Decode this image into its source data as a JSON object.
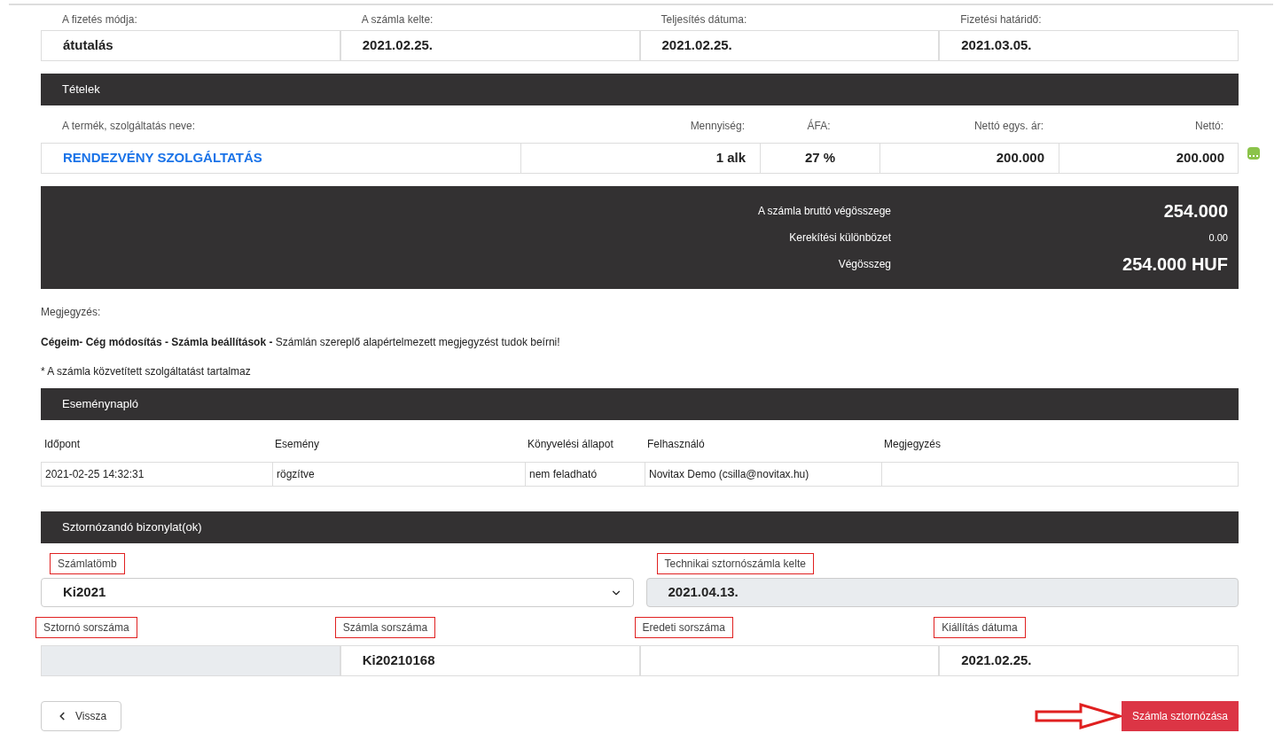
{
  "payment": [
    {
      "label": "A fizetés módja:",
      "value": "átutalás"
    },
    {
      "label": "A számla kelte:",
      "value": "2021.02.25."
    },
    {
      "label": "Teljesítés dátuma:",
      "value": "2021.02.25."
    },
    {
      "label": "Fizetési határidő:",
      "value": "2021.03.05."
    }
  ],
  "items_section": {
    "title": "Tételek",
    "columns": [
      "A termék, szolgáltatás neve:",
      "Mennyiség:",
      "ÁFA:",
      "Nettó egys. ár:",
      "Nettó:"
    ],
    "rows": [
      {
        "name": "RENDEZVÉNY SZOLGÁLTATÁS",
        "quantity": "1 alk",
        "vat": "27 %",
        "unit_net": "200.000",
        "net": "200.000"
      }
    ]
  },
  "totals": [
    {
      "label": "A számla bruttó végösszege",
      "value": "254.000",
      "kind": "large"
    },
    {
      "label": "Kerekítési különbözet",
      "value": "0.00",
      "kind": "small"
    },
    {
      "label": "Végösszeg",
      "value": "254.000 HUF",
      "kind": "large"
    }
  ],
  "note": {
    "label": "Megjegyzés:",
    "text": "**Cégeim- Cég módosítás - Számla beállítások -** Számlán szereplő alapértelmezett megjegyzést tudok beírni!",
    "footnote": "* A számla közvetített szolgáltatást tartalmaz"
  },
  "event_log": {
    "title": "Eseménynapló",
    "columns": [
      "Időpont",
      "Esemény",
      "Könyvelési állapot",
      "Felhasználó",
      "Megjegyzés"
    ],
    "rows": [
      [
        "2021-02-25 14:32:31",
        "rögzítve",
        "nem feladható",
        "Novitax Demo (csilla@novitax.hu)"
      ]
    ]
  },
  "storno": {
    "title": "Sztornózandó bizonylat(ok)",
    "invoice_block": {
      "label": "Számlatömb",
      "value": "Ki2021"
    },
    "technical_date": {
      "label": "Technikai sztornószámla kelte",
      "value": "2021.04.13."
    },
    "fields": [
      {
        "label": "Sztornó sorszáma",
        "disabled": true
      },
      {
        "label": "Számla sorszáma",
        "value": "Ki20210168",
        "disabled": false
      },
      {
        "label": "Eredeti sorszáma",
        "disabled": false
      },
      {
        "label": "Kiállítás dátuma",
        "value": "2021.02.25.",
        "disabled": false
      }
    ]
  },
  "back_button": "Vissza",
  "submit_button": "Számla sztornózása"
}
